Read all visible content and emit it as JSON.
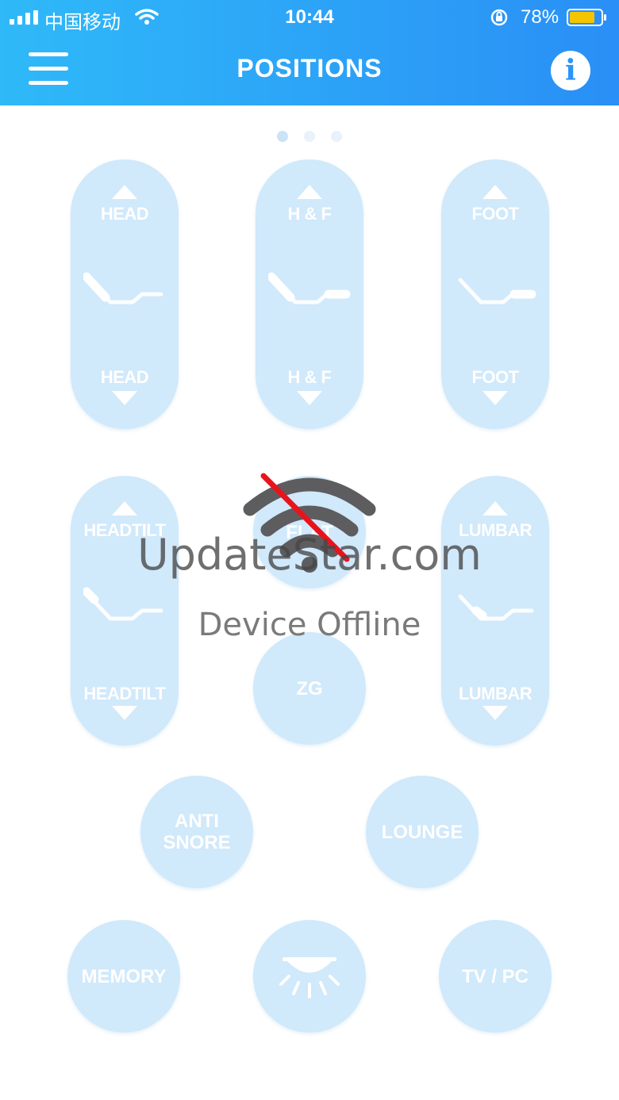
{
  "status_bar": {
    "carrier": "中国移动",
    "time": "10:44",
    "battery": "78%"
  },
  "header": {
    "title": "POSITIONS"
  },
  "pager": {
    "current": 1,
    "total": 3
  },
  "pills_top": [
    {
      "up": "HEAD",
      "down": "HEAD"
    },
    {
      "up": "H & F",
      "down": "H & F"
    },
    {
      "up": "FOOT",
      "down": "FOOT"
    }
  ],
  "pills_mid": [
    {
      "up": "HEADTILT",
      "down": "HEADTILT"
    },
    {
      "up": "LUMBAR",
      "down": "LUMBAR"
    }
  ],
  "circles": {
    "flat": "FLAT",
    "zg": "ZG",
    "anti_snore": "ANTI\nSNORE",
    "lounge": "LOUNGE",
    "memory": "MEMORY",
    "tv_pc": "TV / PC"
  },
  "overlay": {
    "watermark": "UpdateStar.com",
    "message": "Device Offline"
  },
  "colors": {
    "header_start": "#2fb9f8",
    "header_end": "#2a8ff6",
    "button": "#bee1fa",
    "battery": "#f5c400",
    "offline_slash": "#e8141c"
  }
}
